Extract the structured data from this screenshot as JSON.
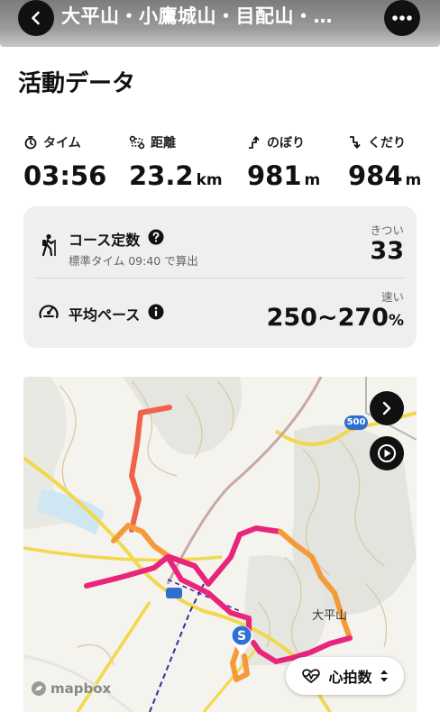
{
  "topbar": {
    "title": "大平山・小鷹城山・目配山・…",
    "back_icon": "chevron-left-icon",
    "more_icon": "ellipsis-icon"
  },
  "section": {
    "title": "活動データ"
  },
  "stats": [
    {
      "icon": "stopwatch-icon",
      "label": "タイム",
      "value": "03:56",
      "unit": ""
    },
    {
      "icon": "route-icon",
      "label": "距離",
      "value": "23.2",
      "unit": "km"
    },
    {
      "icon": "ascent-icon",
      "label": "のぼり",
      "value": "981",
      "unit": "m"
    },
    {
      "icon": "descent-icon",
      "label": "くだり",
      "value": "984",
      "unit": "m"
    }
  ],
  "course": {
    "title": "コース定数",
    "subtitle": "標準タイム 09:40 で算出",
    "right_label": "きつい",
    "right_value": "33"
  },
  "pace": {
    "title": "平均ペース",
    "right_label": "速い",
    "right_value": "250~270",
    "right_unit": "%"
  },
  "map": {
    "road_number": "500",
    "place_label": "大平山",
    "start_marker": "S",
    "metric_selector": "心拍数",
    "attribution": "mapbox",
    "route_colors": [
      "#e8257a",
      "#f0624a",
      "#f59a3a"
    ]
  }
}
